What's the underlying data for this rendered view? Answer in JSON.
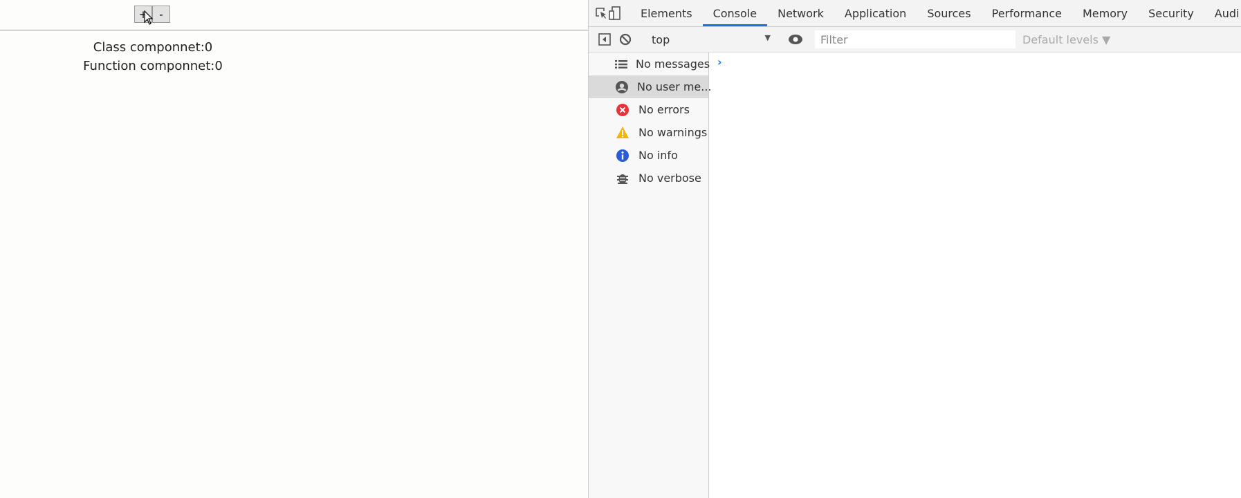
{
  "page": {
    "plus_label": "+",
    "minus_label": "-",
    "class_counter": "Class componnet:0",
    "function_counter": "Function componnet:0"
  },
  "devtools": {
    "tabs": [
      "Elements",
      "Console",
      "Network",
      "Application",
      "Sources",
      "Performance",
      "Memory",
      "Security",
      "Audi"
    ],
    "active_tab": "Console",
    "context": "top",
    "filter_placeholder": "Filter",
    "levels": "Default levels ▼",
    "sidebar": [
      {
        "label": "No messages",
        "icon": "list-icon"
      },
      {
        "label": "No user me...",
        "icon": "user-icon",
        "selected": true
      },
      {
        "label": "No errors",
        "icon": "error-icon",
        "color": "#e8323c"
      },
      {
        "label": "No warnings",
        "icon": "warning-icon",
        "color": "#f4b400"
      },
      {
        "label": "No info",
        "icon": "info-icon",
        "color": "#2a5bd7"
      },
      {
        "label": "No verbose",
        "icon": "bug-icon"
      }
    ],
    "prompt": "›"
  }
}
